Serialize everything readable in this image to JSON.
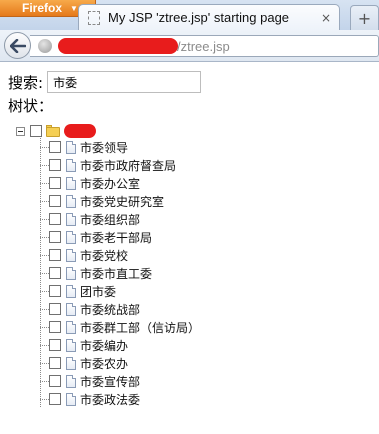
{
  "browser": {
    "menu_button": "Firefox",
    "tab_title": "My JSP 'ztree.jsp' starting page",
    "tab_close": "×",
    "new_tab": "+",
    "url_visible": "/ztree.jsp"
  },
  "page": {
    "search_label": "搜索:",
    "search_value": "市委",
    "tree_label": "树状：",
    "tree": {
      "items": [
        {
          "label": "市委领导"
        },
        {
          "label": "市委市政府督查局"
        },
        {
          "label": "市委办公室"
        },
        {
          "label": "市委党史研究室"
        },
        {
          "label": "市委组织部"
        },
        {
          "label": "市委老干部局"
        },
        {
          "label": "市委党校"
        },
        {
          "label": "市委市直工委"
        },
        {
          "label": "团市委"
        },
        {
          "label": "市委统战部"
        },
        {
          "label": "市委群工部（信访局）"
        },
        {
          "label": "市委编办"
        },
        {
          "label": "市委农办"
        },
        {
          "label": "市委宣传部"
        },
        {
          "label": "市委政法委"
        }
      ]
    }
  },
  "colors": {
    "redaction": "#e81c1c",
    "firefox_button": "#e5791a",
    "folder": "#f5cf54"
  }
}
